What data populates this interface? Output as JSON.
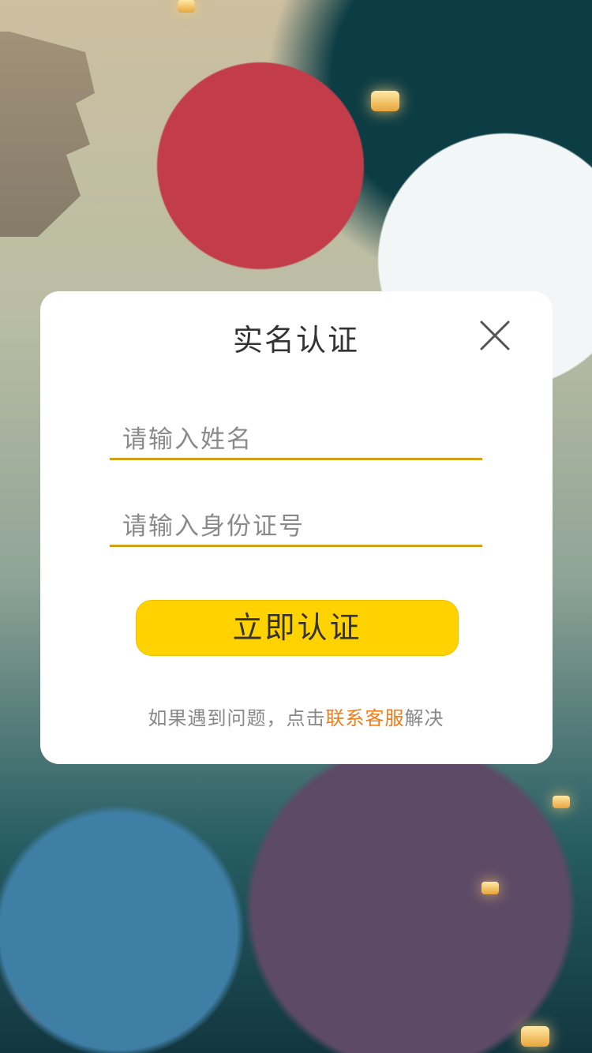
{
  "dialog": {
    "title": "实名认证",
    "name_placeholder": "请输入姓名",
    "id_placeholder": "请输入身份证号",
    "submit_label": "立即认证",
    "help_prefix": "如果遇到问题，点击",
    "help_link": "联系客服",
    "help_suffix": "解决"
  },
  "icons": {
    "close": "close-icon"
  },
  "colors": {
    "accent_button": "#ffd200",
    "input_underline": "#d4a017",
    "link": "#ef7d1a",
    "title_text": "#333333",
    "hint_text": "#888888"
  }
}
